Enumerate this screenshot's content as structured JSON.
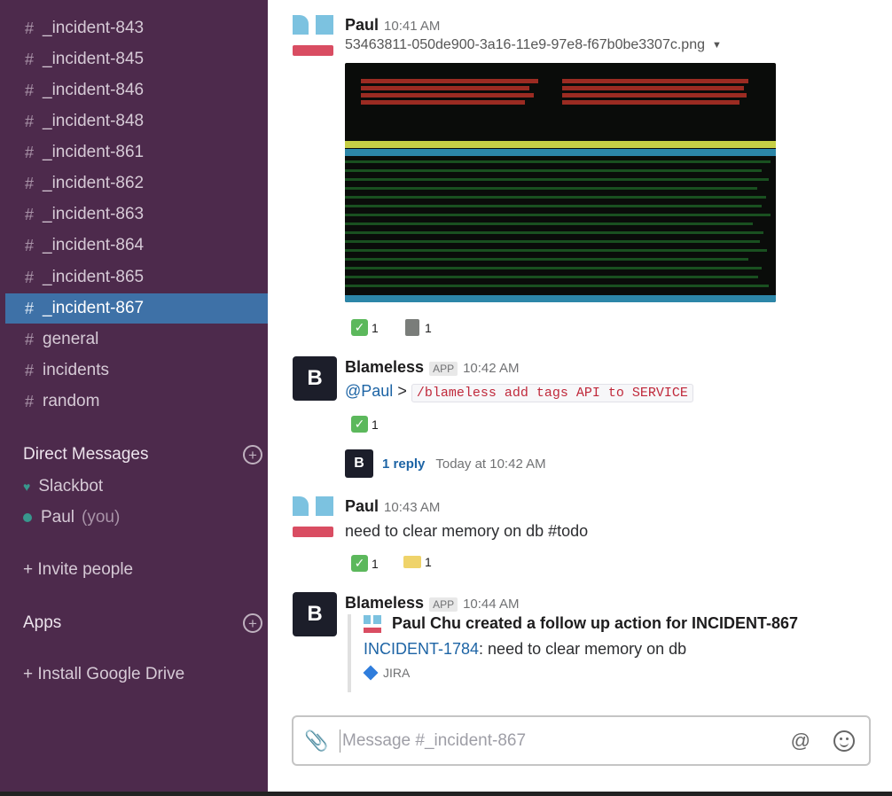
{
  "sidebar": {
    "channels": [
      {
        "label": "_incident-843",
        "active": false
      },
      {
        "label": "_incident-845",
        "active": false
      },
      {
        "label": "_incident-846",
        "active": false
      },
      {
        "label": "_incident-848",
        "active": false
      },
      {
        "label": "_incident-861",
        "active": false
      },
      {
        "label": "_incident-862",
        "active": false
      },
      {
        "label": "_incident-863",
        "active": false
      },
      {
        "label": "_incident-864",
        "active": false
      },
      {
        "label": "_incident-865",
        "active": false
      },
      {
        "label": "_incident-867",
        "active": true
      },
      {
        "label": "general",
        "active": false
      },
      {
        "label": "incidents",
        "active": false
      },
      {
        "label": "random",
        "active": false
      }
    ],
    "hash": "#",
    "direct_messages_label": "Direct Messages",
    "dms": [
      {
        "name": "Slackbot",
        "suffix": ""
      },
      {
        "name": "Paul",
        "suffix": "(you)"
      }
    ],
    "invite_label": "+ Invite people",
    "apps_label": "Apps",
    "install_label": "+ Install Google Drive",
    "plus": "+"
  },
  "messages": {
    "m1": {
      "author": "Paul",
      "time": "10:41 AM",
      "filename": "53463811-050de900-3a16-11e9-97e8-f67b0be3307c.png",
      "reactions": [
        {
          "emoji": "white-check-mark",
          "count": "1"
        },
        {
          "emoji": "book",
          "count": "1"
        }
      ]
    },
    "m2": {
      "author": "Blameless",
      "app_tag": "APP",
      "time": "10:42 AM",
      "mention": "@Paul",
      "arrow": ">",
      "command": "/blameless add tags API to SERVICE",
      "reactions": [
        {
          "emoji": "white-check-mark",
          "count": "1"
        }
      ],
      "reply_count": "1 reply",
      "reply_time": "Today at 10:42 AM"
    },
    "m3": {
      "author": "Paul",
      "time": "10:43 AM",
      "text": "need to clear memory on db #todo",
      "reactions": [
        {
          "emoji": "white-check-mark",
          "count": "1"
        },
        {
          "emoji": "memo",
          "count": "1"
        }
      ]
    },
    "m4": {
      "author": "Blameless",
      "app_tag": "APP",
      "time": "10:44 AM",
      "attachment": {
        "title": "Paul Chu created a follow up action for INCIDENT-867",
        "link": "INCIDENT-1784",
        "rest": ": need to clear memory on db",
        "footer": "JIRA"
      }
    }
  },
  "composer": {
    "placeholder": "Message #_incident-867"
  },
  "glyphs": {
    "check": "✓",
    "clip": "📎",
    "at": "@",
    "caret": "▼",
    "heart": "♥",
    "bl": "B"
  },
  "colors": {
    "sidebar_bg": "#4d2a4c",
    "active_channel": "#3e71a7",
    "link": "#1d64a5",
    "command_red": "#c0293b"
  }
}
